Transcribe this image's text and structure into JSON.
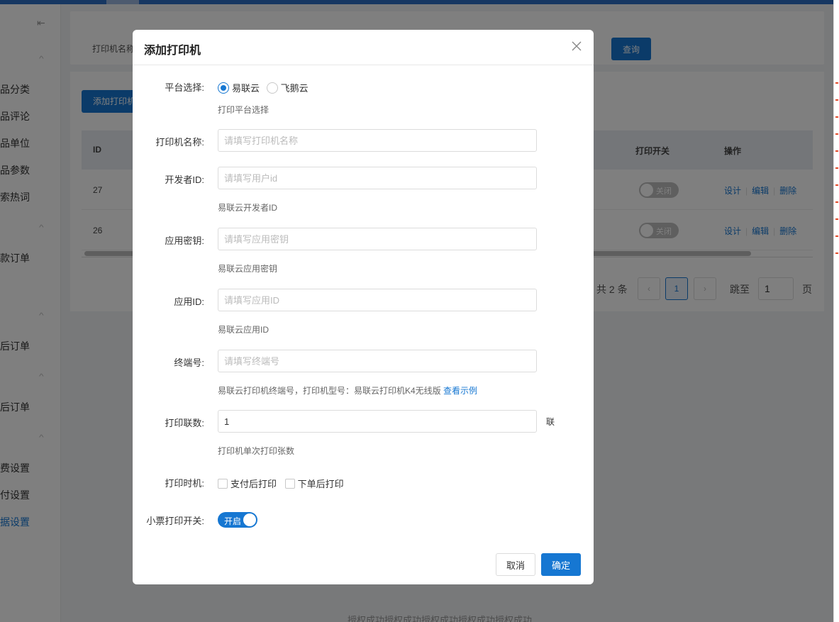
{
  "sidebar": {
    "items": [
      "商品分类",
      "商品评论",
      "商品单位",
      "商品参数",
      "搜索热词",
      "收款订单",
      "售后订单",
      "售后订单",
      "运费设置",
      "支付设置",
      "票据设置"
    ]
  },
  "search": {
    "label": "打印机名称",
    "query_button": "查询"
  },
  "table": {
    "add_button": "添加打印机",
    "columns": {
      "id": "ID",
      "switch": "打印开关",
      "actions": "操作"
    },
    "rows": [
      {
        "id": "27",
        "switch_text": "关闭",
        "ops": [
          "设计",
          "编辑",
          "删除"
        ]
      },
      {
        "id": "26",
        "switch_text": "关闭",
        "ops": [
          "设计",
          "编辑",
          "删除"
        ]
      }
    ]
  },
  "pagination": {
    "total": "共 2 条",
    "current": "1",
    "jump_label": "跳至",
    "jump_value": "1",
    "page_suffix": "页",
    "prev_icon": "chevron-left-icon",
    "next_icon": "chevron-right-icon"
  },
  "footer_text": "授权成功授权成功授权成功授权成功授权成功",
  "modal": {
    "title": "添加打印机",
    "fields": {
      "platform": {
        "label": "平台选择:",
        "options": [
          "易联云",
          "飞鹅云"
        ],
        "selected": "易联云",
        "hint": "打印平台选择"
      },
      "name": {
        "label": "打印机名称:",
        "placeholder": "请填写打印机名称"
      },
      "developer_id": {
        "label": "开发者ID:",
        "placeholder": "请填写用户id",
        "hint": "易联云开发者ID"
      },
      "app_secret": {
        "label": "应用密钥:",
        "placeholder": "请填写应用密钥",
        "hint": "易联云应用密钥"
      },
      "app_id": {
        "label": "应用ID:",
        "placeholder": "请填写应用ID",
        "hint": "易联云应用ID"
      },
      "terminal": {
        "label": "终端号:",
        "placeholder": "请填写终端号",
        "hint": "易联云打印机终端号，打印机型号：易联云打印机K4无线版",
        "hint_link": "查看示例"
      },
      "copies": {
        "label": "打印联数:",
        "value": "1",
        "unit": "联",
        "hint": "打印机单次打印张数"
      },
      "timing": {
        "label": "打印时机:",
        "options": [
          "支付后打印",
          "下单后打印"
        ]
      },
      "receipt_switch": {
        "label": "小票打印开关:",
        "value": "开启"
      }
    },
    "buttons": {
      "cancel": "取消",
      "ok": "确定"
    }
  },
  "colors": {
    "primary": "#1677d2",
    "overlay": "rgba(0,0,0,0.5)"
  }
}
